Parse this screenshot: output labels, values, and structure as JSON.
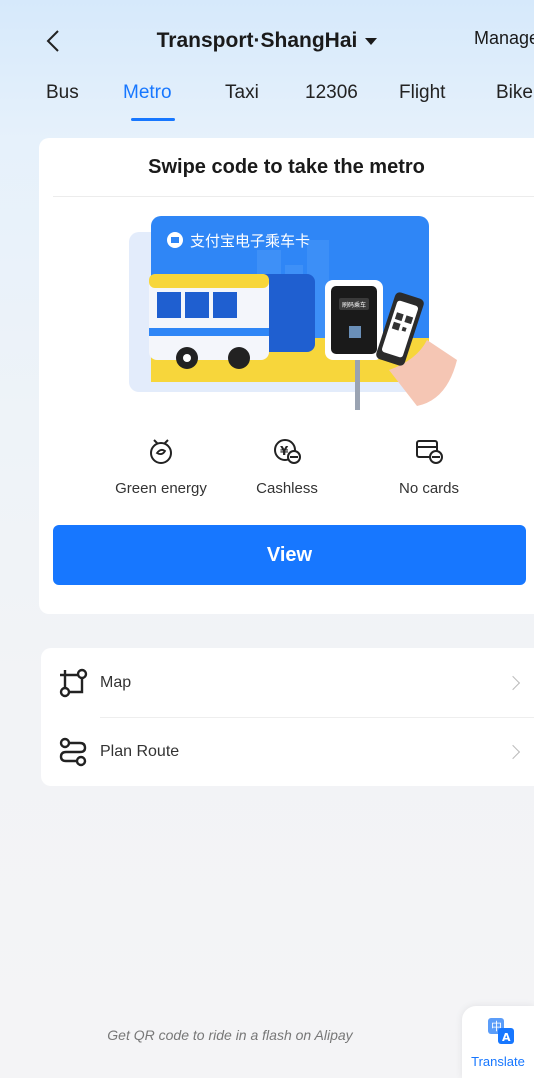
{
  "header": {
    "title": "Transport·ShangHai",
    "manage_label": "Manage"
  },
  "tabs": [
    {
      "label": "Bus",
      "active": false
    },
    {
      "label": "Metro",
      "active": true
    },
    {
      "label": "Taxi",
      "active": false
    },
    {
      "label": "12306",
      "active": false
    },
    {
      "label": "Flight",
      "active": false
    },
    {
      "label": "Bike",
      "active": false
    }
  ],
  "metro_card": {
    "title": "Swipe code to take the metro",
    "banner": {
      "card_name": "支付宝电子乘车卡",
      "gate_label": "刷码乘车"
    },
    "features": [
      {
        "icon": "leaf-clock-icon",
        "label": "Green energy"
      },
      {
        "icon": "yuan-coin-icon",
        "label": "Cashless"
      },
      {
        "icon": "card-icon",
        "label": "No cards"
      }
    ],
    "button_label": "View"
  },
  "menu": [
    {
      "icon": "map-icon",
      "label": "Map"
    },
    {
      "icon": "route-icon",
      "label": "Plan Route"
    }
  ],
  "footer": {
    "text": "Get QR code to ride in a flash on Alipay",
    "translate_label": "Translate"
  },
  "colors": {
    "accent": "#1777ff",
    "banner_blue": "#2f86f6",
    "banner_yellow": "#f7d63b"
  }
}
